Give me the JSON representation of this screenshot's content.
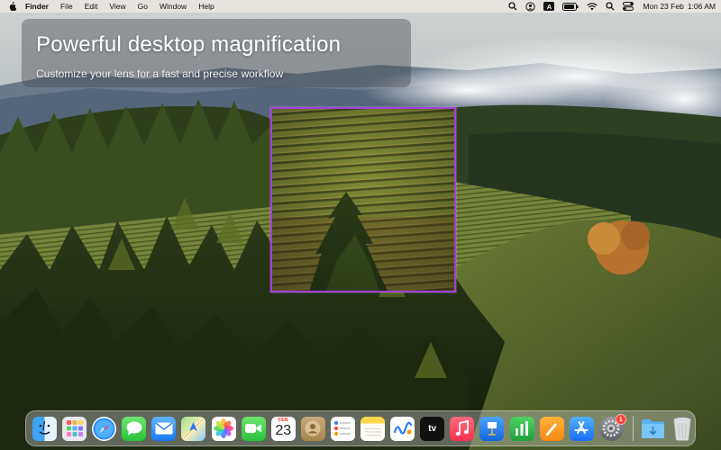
{
  "menubar": {
    "app_name": "Finder",
    "menus": [
      "File",
      "Edit",
      "View",
      "Go",
      "Window",
      "Help"
    ],
    "status_icons": [
      "search-icon",
      "user-circle-icon",
      "input-source-icon",
      "battery-icon",
      "wifi-icon",
      "spotlight-search-icon",
      "control-center-icon"
    ],
    "input_source_label": "A",
    "date": "Mon 23 Feb",
    "time": "1:06 AM"
  },
  "promo": {
    "title": "Powerful desktop magnification",
    "subtitle": "Customize your lens for a fast and precise workflow"
  },
  "lens": {
    "border_color": "#a33fe0"
  },
  "dock": {
    "apps": [
      {
        "name": "Finder",
        "icon": "finder-icon"
      },
      {
        "name": "Launchpad",
        "icon": "launchpad-icon"
      },
      {
        "name": "Safari",
        "icon": "safari-icon"
      },
      {
        "name": "Messages",
        "icon": "messages-icon"
      },
      {
        "name": "Mail",
        "icon": "mail-icon"
      },
      {
        "name": "Maps",
        "icon": "maps-icon"
      },
      {
        "name": "Photos",
        "icon": "photos-icon"
      },
      {
        "name": "FaceTime",
        "icon": "facetime-icon"
      },
      {
        "name": "Calendar",
        "icon": "calendar-icon",
        "month": "FEB",
        "day": "23"
      },
      {
        "name": "Contacts",
        "icon": "contacts-icon"
      },
      {
        "name": "Reminders",
        "icon": "reminders-icon"
      },
      {
        "name": "Notes",
        "icon": "notes-icon"
      },
      {
        "name": "Freeform",
        "icon": "freeform-icon"
      },
      {
        "name": "TV",
        "icon": "apple-tv-icon",
        "label": "tv"
      },
      {
        "name": "Music",
        "icon": "music-icon"
      },
      {
        "name": "Keynote",
        "icon": "keynote-icon"
      },
      {
        "name": "Numbers",
        "icon": "numbers-icon"
      },
      {
        "name": "Pages",
        "icon": "pages-icon"
      },
      {
        "name": "App Store",
        "icon": "app-store-icon"
      },
      {
        "name": "System Settings",
        "icon": "system-settings-icon",
        "badge": "1"
      }
    ],
    "folders": [
      {
        "name": "Downloads",
        "icon": "downloads-folder-icon"
      },
      {
        "name": "Trash",
        "icon": "trash-icon"
      }
    ]
  }
}
